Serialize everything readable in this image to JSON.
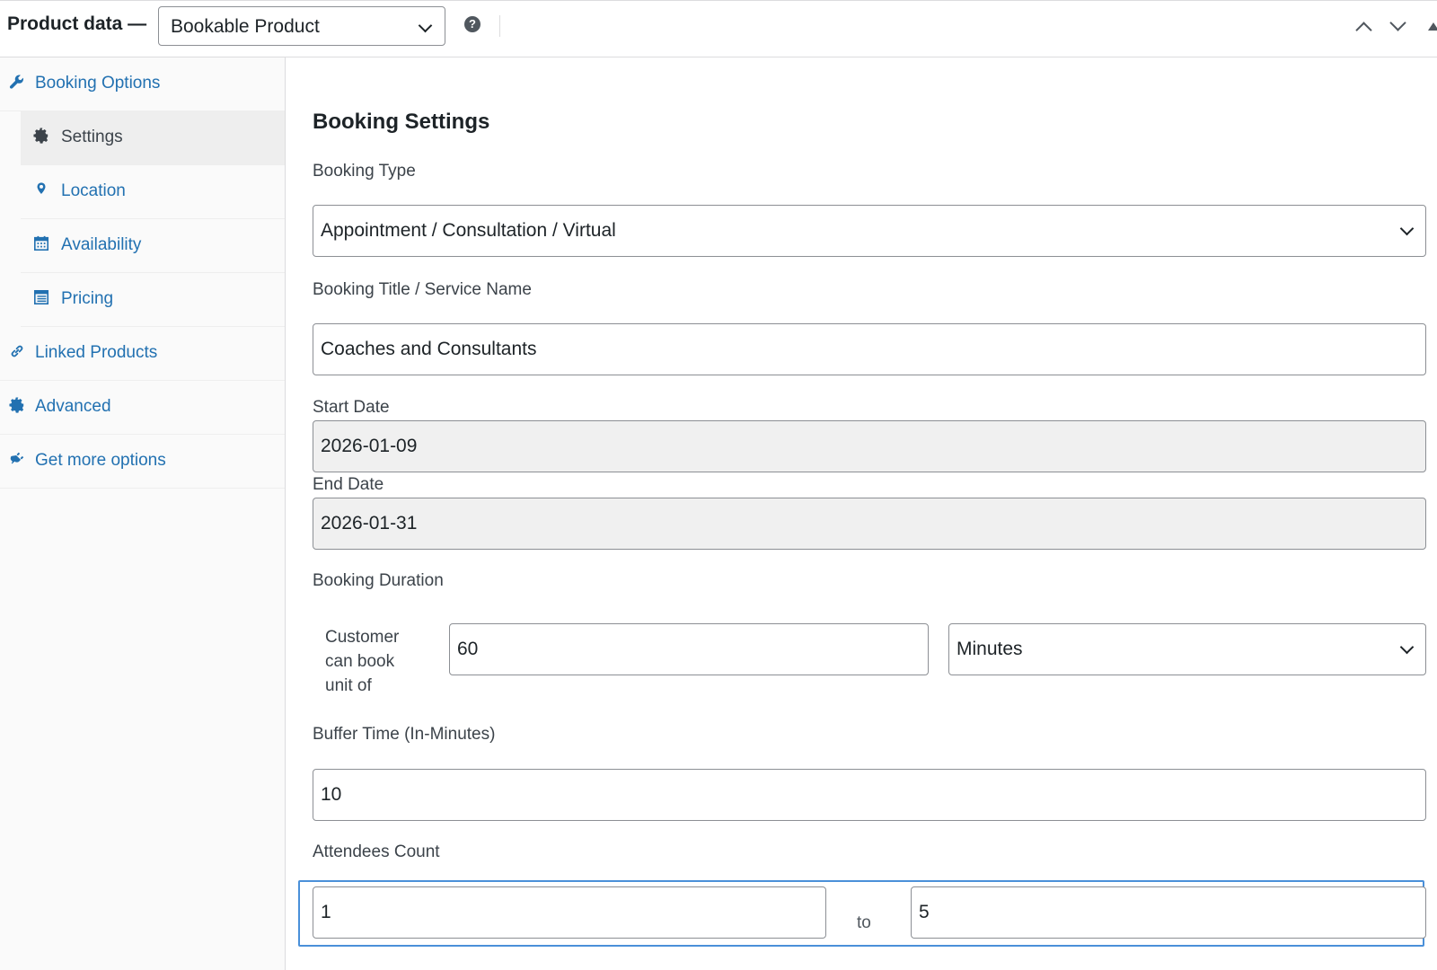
{
  "header": {
    "title": "Product data —",
    "product_type": "Bookable Product",
    "help_icon": "?"
  },
  "sidebar": {
    "items": [
      {
        "label": "Booking Options",
        "icon": "wrench-icon"
      },
      {
        "label": "Settings",
        "icon": "gear-icon"
      },
      {
        "label": "Location",
        "icon": "map-pin-icon"
      },
      {
        "label": "Availability",
        "icon": "calendar-icon"
      },
      {
        "label": "Pricing",
        "icon": "table-icon"
      },
      {
        "label": "Linked Products",
        "icon": "link-icon"
      },
      {
        "label": "Advanced",
        "icon": "gear-icon"
      },
      {
        "label": "Get more options",
        "icon": "plugin-icon"
      }
    ]
  },
  "main": {
    "section_title": "Booking Settings",
    "booking_type": {
      "label": "Booking Type",
      "value": "Appointment / Consultation / Virtual"
    },
    "booking_title": {
      "label": "Booking Title / Service Name",
      "value": "Coaches and Consultants"
    },
    "start_date": {
      "label": "Start Date",
      "value": "2026-01-09"
    },
    "end_date": {
      "label": "End Date",
      "value": "2026-01-31"
    },
    "booking_duration": {
      "label": "Booking Duration",
      "unit_label": "Customer can book unit of",
      "value": "60",
      "unit": "Minutes"
    },
    "buffer_time": {
      "label": "Buffer Time (In-Minutes)",
      "value": "10"
    },
    "attendees": {
      "label": "Attendees Count",
      "min": "1",
      "to_label": "to",
      "max": "5"
    }
  },
  "colors": {
    "accent": "#2271b1",
    "focus": "#4a90d9",
    "readonly_bg": "#f0f0f0"
  }
}
